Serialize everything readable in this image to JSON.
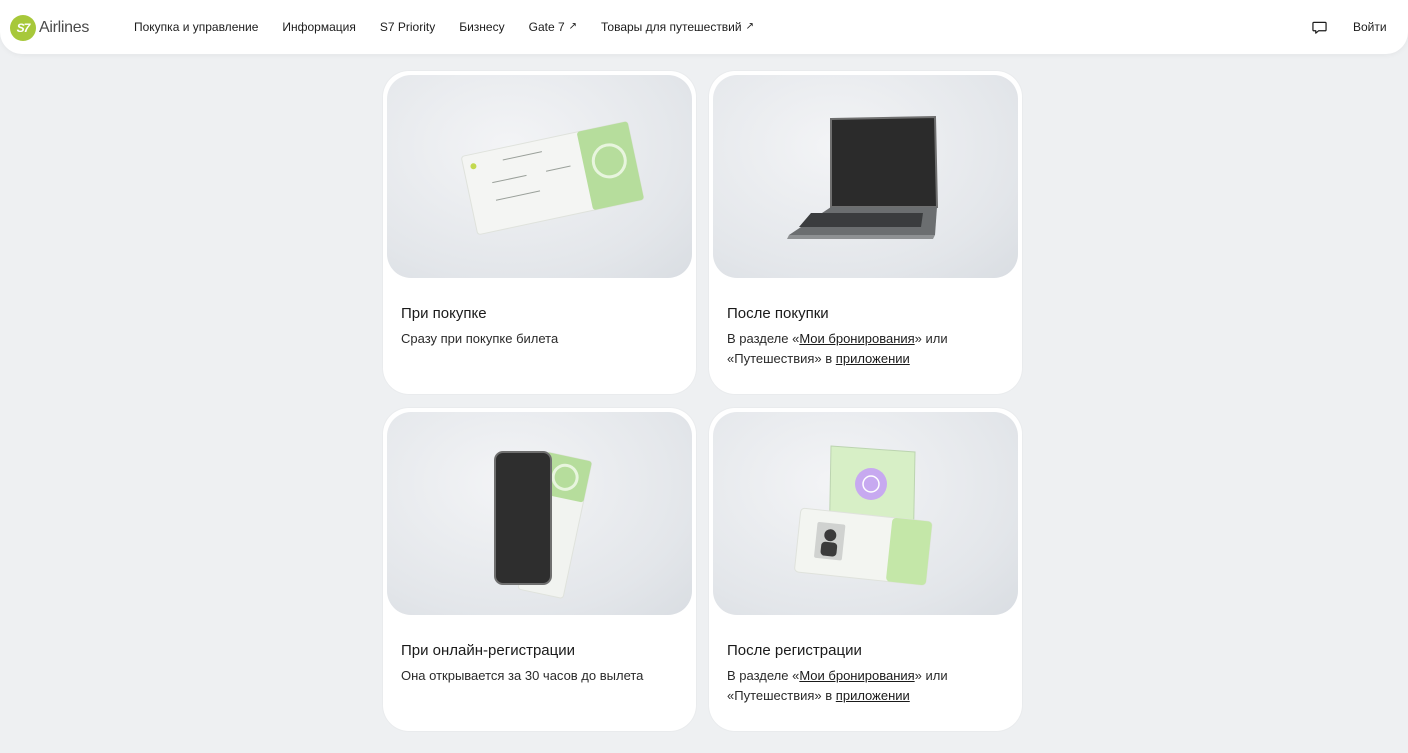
{
  "header": {
    "logo_badge": "S7",
    "logo_text": "Airlines",
    "nav": [
      {
        "label": "Покупка и управление",
        "external": false
      },
      {
        "label": "Информация",
        "external": false
      },
      {
        "label": "S7 Priority",
        "external": false
      },
      {
        "label": "Бизнесу",
        "external": false
      },
      {
        "label": "Gate 7",
        "external": true
      },
      {
        "label": "Товары для путешествий",
        "external": true
      }
    ],
    "external_icon": "↗",
    "chat_icon": "chat-bubble-icon",
    "login_label": "Войти"
  },
  "colors": {
    "brand": "#a7c83a",
    "background": "#eef0f2",
    "card": "#ffffff"
  },
  "cards": [
    {
      "title": "При покупке",
      "desc": "Сразу при покупке билета",
      "image": "boarding-pass-illustration"
    },
    {
      "title": "После покупки",
      "desc_prefix": "В разделе «",
      "desc_link1": "Мои бронирования",
      "desc_mid": "» или «Путешествия» в ",
      "desc_link2": "приложении",
      "image": "laptop-illustration"
    },
    {
      "title": "При онлайн-регистрации",
      "desc": "Она открывается за 30 часов до вылета",
      "image": "phone-ticket-illustration"
    },
    {
      "title": "После регистрации",
      "desc_prefix": "В разделе «",
      "desc_link1": "Мои бронирования",
      "desc_mid": "» или «Путешествия» в ",
      "desc_link2": "приложении",
      "image": "passport-illustration"
    }
  ]
}
